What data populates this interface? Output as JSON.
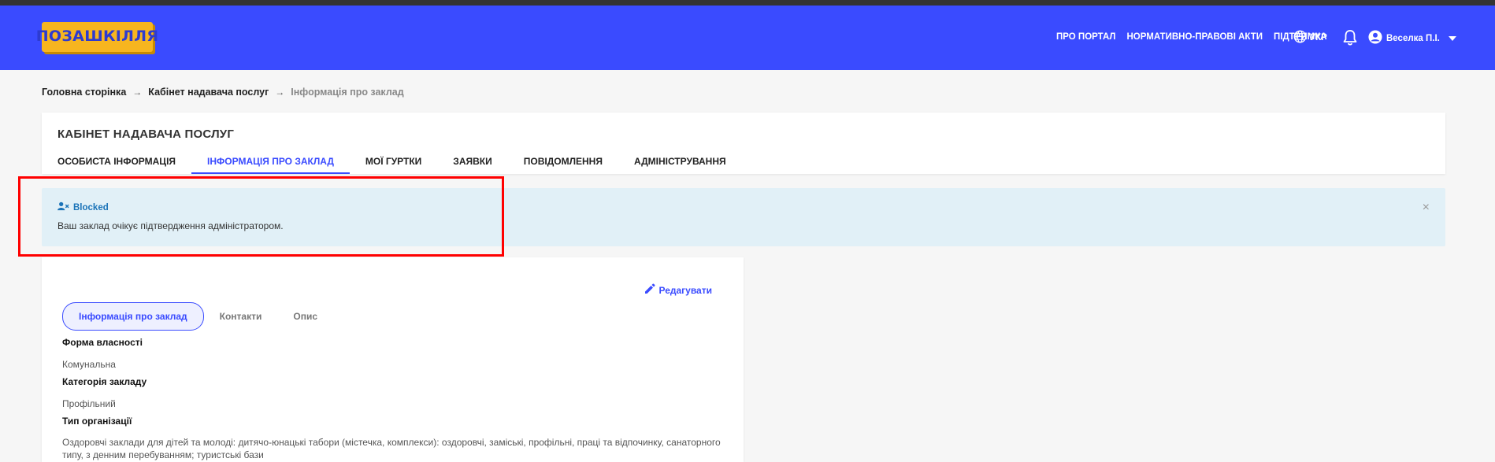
{
  "header": {
    "logo_text": "ПОЗАШКІЛЛЯ",
    "nav": [
      "ПРО ПОРТАЛ",
      "НОРМАТИВНО-ПРАВОВІ АКТИ",
      "ПІДТРИМКА"
    ],
    "language": "УКР",
    "user_name": "Веселка П.І."
  },
  "breadcrumb": {
    "items": [
      "Головна сторінка",
      "Кабінет надавача послуг"
    ],
    "current": "Інформація про заклад"
  },
  "cabinet": {
    "title": "КАБІНЕТ НАДАВАЧА ПОСЛУГ",
    "tabs": [
      "ОСОБИСТА ІНФОРМАЦІЯ",
      "ІНФОРМАЦІЯ ПРО ЗАКЛАД",
      "МОЇ ГУРТКИ",
      "ЗАЯВКИ",
      "ПОВІДОМЛЕННЯ",
      "АДМІНІСТРУВАННЯ"
    ],
    "active_tab_index": 1
  },
  "alert": {
    "title": "Blocked",
    "message": "Ваш заклад очікує підтвердження адміністратором.",
    "close": "×"
  },
  "info": {
    "edit_label": "Редагувати",
    "subtabs": [
      "Інформація про заклад",
      "Контакти",
      "Опис"
    ],
    "active_subtab_index": 0,
    "fields": [
      {
        "label": "Форма власності",
        "value": "Комунальна"
      },
      {
        "label": "Категорія закладу",
        "value": "Профільний"
      },
      {
        "label": "Тип організації",
        "value": "Оздоровчі заклади для дітей та молоді: дитячо-юнацькі табори (містечка, комплекси): оздоровчі, заміські, профільні, праці та відпочинку, санаторного типу, з денним перебуванням; туристські бази"
      }
    ]
  },
  "colors": {
    "primary": "#3a4bff",
    "logo_bg": "#f7b51f",
    "alert_bg": "#e1f0f7",
    "alert_text": "#1a73b8",
    "highlight": "#ff0000"
  }
}
